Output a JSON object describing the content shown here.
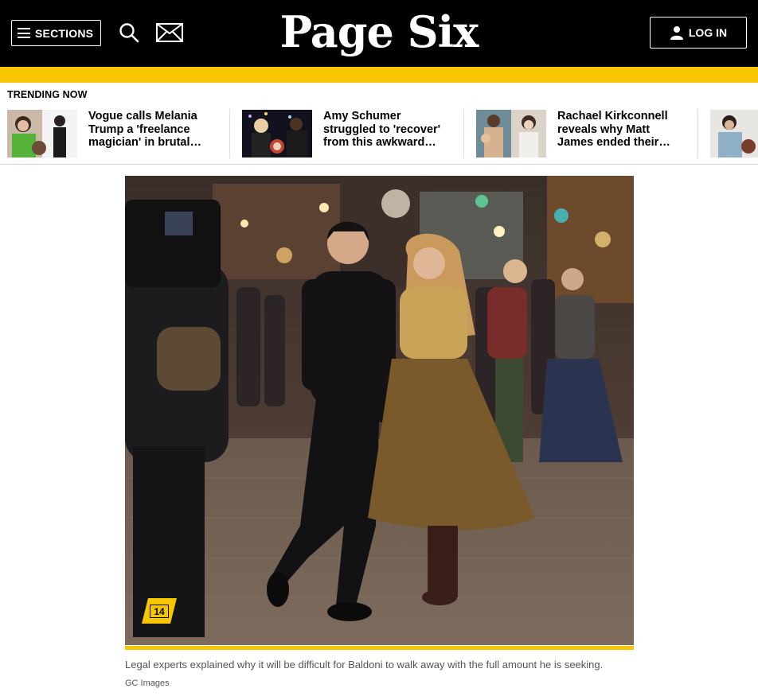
{
  "header": {
    "sections_label": "SECTIONS",
    "logo_text": "Page Six",
    "login_label": "LOG IN",
    "background": "#000000",
    "accent": "#f7c600"
  },
  "trending": {
    "label": "TRENDING NOW",
    "items": [
      {
        "title": "Vogue calls Melania Trump a 'freelance magician' in brutal…"
      },
      {
        "title": "Amy Schumer struggled to 'recover' from this awkward…"
      },
      {
        "title": "Rachael Kirkconnell reveals why Matt James ended their…"
      },
      {
        "title": ""
      }
    ]
  },
  "article": {
    "gallery_count": "14",
    "caption": "Legal experts explained why it will be difficult for Baldoni to walk away with the full amount he is seeking.",
    "credit": "GC Images"
  },
  "icons": [
    "hamburger-icon",
    "search-icon",
    "mail-icon",
    "user-icon",
    "gallery-icon"
  ]
}
